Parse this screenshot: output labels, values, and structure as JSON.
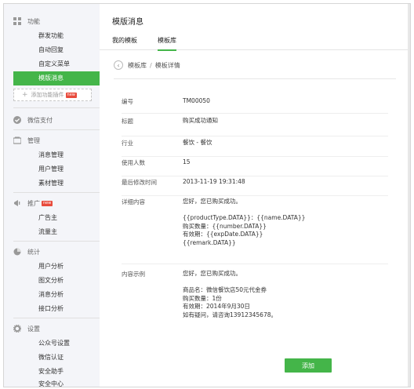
{
  "sidebar": {
    "func": {
      "title": "功能",
      "items": [
        "群发功能",
        "自动回复",
        "自定义菜单",
        "模版消息"
      ],
      "add_plugin": "添加功能插件",
      "new_badge": "new"
    },
    "pay": {
      "title": "微信支付"
    },
    "manage": {
      "title": "管理",
      "items": [
        "消息管理",
        "用户管理",
        "素材管理"
      ]
    },
    "promote": {
      "title": "推广",
      "badge": "new",
      "items": [
        "广告主",
        "流量主"
      ]
    },
    "stats": {
      "title": "统计",
      "items": [
        "用户分析",
        "图文分析",
        "消息分析",
        "接口分析"
      ]
    },
    "settings": {
      "title": "设置",
      "items": [
        "公众号设置",
        "微信认证",
        "安全助手",
        "安全中心"
      ]
    }
  },
  "main": {
    "title": "模版消息",
    "tabs": [
      "我的模板",
      "模板库"
    ],
    "breadcrumb": {
      "parent": "模板库",
      "separator": "/",
      "current": "模板详情"
    },
    "fields": [
      {
        "label": "编号",
        "value": "TM00050"
      },
      {
        "label": "标题",
        "value": "购买成功通知"
      },
      {
        "label": "行业",
        "value": "餐饮 - 餐饮"
      },
      {
        "label": "使用人数",
        "value": "15"
      },
      {
        "label": "最后修改时间",
        "value": "2013-11-19 19:31:48"
      },
      {
        "label": "详细内容",
        "value": "您好，您已购买成功。\n\n{{productType.DATA}}：{{name.DATA}}\n购买数量：{{number.DATA}}\n有效期：{{expDate.DATA}}\n{{remark.DATA}}"
      },
      {
        "label": "内容示例",
        "value": "您好，您已购买成功。\n\n商品名：微信餐饮店50元代金券\n购买数量：1份\n有效期：2014年9月30日\n如有疑问，请咨询13912345678。"
      }
    ],
    "add_button": "添加"
  },
  "colors": {
    "accent": "#44b549",
    "badge": "#e84b3c"
  }
}
